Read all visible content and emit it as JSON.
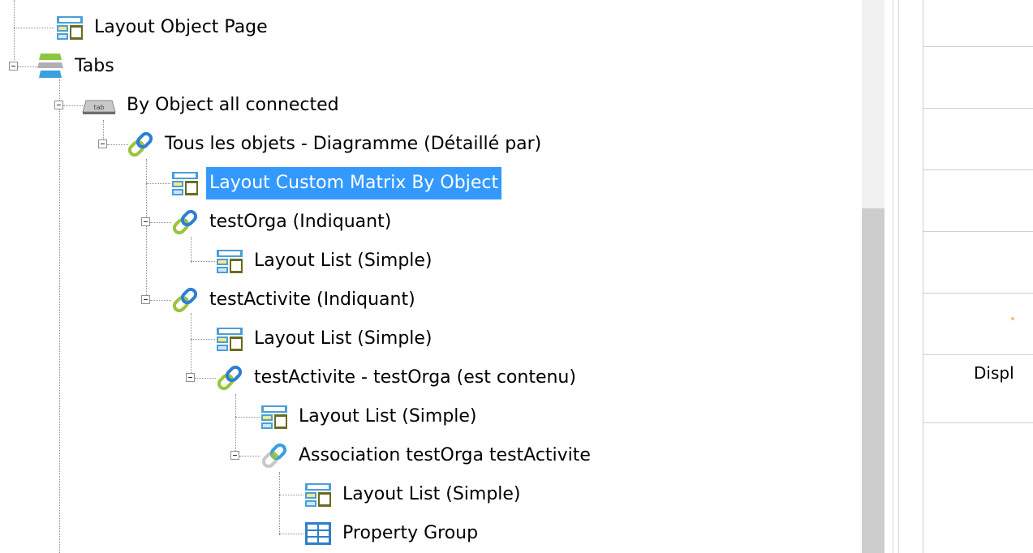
{
  "tree": {
    "nodes": [
      {
        "label": "Layout Object Page",
        "icon": "layout-icon"
      },
      {
        "label": "Tabs",
        "icon": "tabs-icon"
      },
      {
        "label": "By Object all connected",
        "icon": "tab-icon"
      },
      {
        "label": "Tous les objets - Diagramme (Détaillé par)",
        "icon": "link-icon"
      },
      {
        "label": "Layout Custom Matrix By Object",
        "icon": "layout-icon",
        "selected": true
      },
      {
        "label": "testOrga (Indiquant)",
        "icon": "link-icon"
      },
      {
        "label": "Layout List (Simple)",
        "icon": "layout-icon"
      },
      {
        "label": "testActivite (Indiquant)",
        "icon": "link-icon"
      },
      {
        "label": "Layout List (Simple)",
        "icon": "layout-icon"
      },
      {
        "label": "testActivite - testOrga (est contenu)",
        "icon": "link-icon"
      },
      {
        "label": "Layout List (Simple)",
        "icon": "layout-icon"
      },
      {
        "label": "Association testOrga testActivite",
        "icon": "association-link-icon"
      },
      {
        "label": "Layout List (Simple)",
        "icon": "layout-icon"
      },
      {
        "label": "Property Group",
        "icon": "property-group-icon"
      }
    ]
  },
  "side_grid": {
    "cell_text": "Displ"
  },
  "colors": {
    "selection": "#3399ff",
    "layout_blue": "#4a9fd8",
    "layout_olive": "#6b6b1f",
    "link_green": "#9ac43c",
    "link_blue": "#2f7fd3"
  }
}
